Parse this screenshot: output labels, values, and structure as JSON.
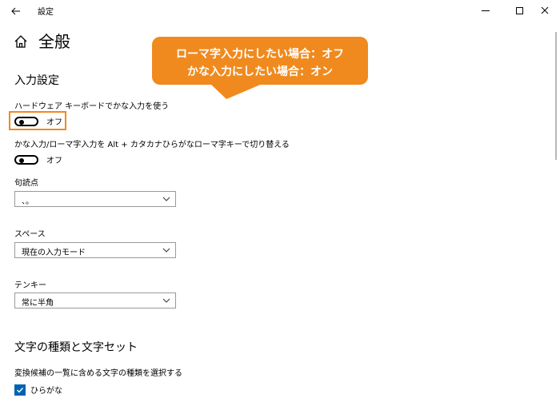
{
  "window": {
    "title": "設定",
    "back_icon": "back-arrow-icon",
    "controls": [
      "minimize-icon",
      "maximize-icon",
      "close-icon"
    ]
  },
  "page": {
    "title": "全般",
    "home_icon": "home-icon"
  },
  "input_settings": {
    "heading": "入力設定",
    "hw_keyboard_kana": {
      "label": "ハードウェア キーボードでかな入力を使う",
      "state": "オフ",
      "on": false
    },
    "alt_kana_toggle": {
      "label": "かな入力/ローマ字入力を Alt + カタカナひらがなローマ字キーで切り替える",
      "state": "オフ",
      "on": false
    },
    "punctuation": {
      "label": "句読点",
      "value": "、。"
    },
    "space": {
      "label": "スペース",
      "value": "現在の入力モード"
    },
    "tenkey": {
      "label": "テンキー",
      "value": "常に半角"
    }
  },
  "charset": {
    "heading": "文字の種類と文字セット",
    "description": "変換候補の一覧に含める文字の種類を選択する",
    "hiragana": {
      "label": "ひらがな",
      "checked": true
    }
  },
  "callout": {
    "line1": "ローマ字入力にしたい場合：オフ",
    "line2": "かな入力にしたい場合：オン",
    "color": "#f08a1e"
  },
  "colors": {
    "accent": "#0063b1",
    "highlight": "#f08a1e"
  }
}
